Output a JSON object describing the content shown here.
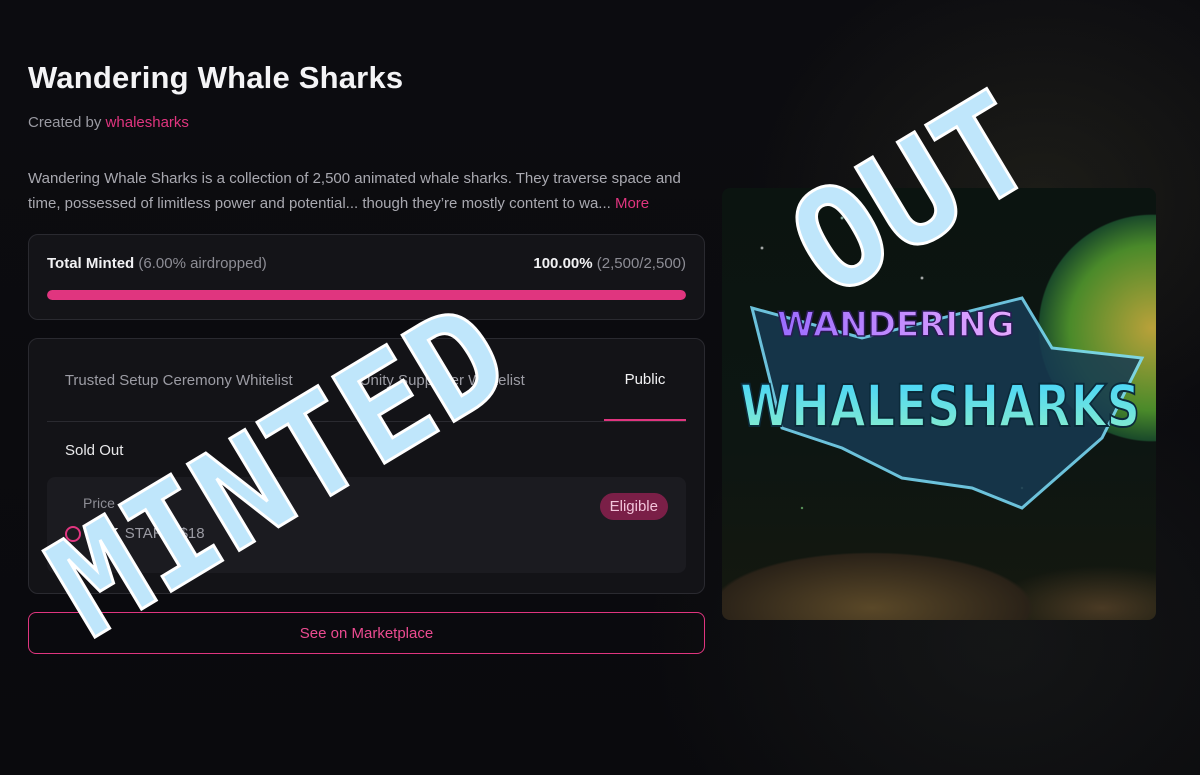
{
  "collection": {
    "title": "Wandering Whale Sharks",
    "created_by_prefix": "Created by",
    "creator": "whalesharks",
    "description": "Wandering Whale Sharks is a collection of 2,500 animated whale sharks. They traverse space and time, possessed of limitless power and potential... though they’re mostly content to wa...",
    "more_link": "More"
  },
  "minting": {
    "label": "Total Minted",
    "airdrop_note": "(6.00% airdropped)",
    "percent_text": "100.00%",
    "count_text": "(2,500/2,500)",
    "progress_percent": 100
  },
  "phases": {
    "tabs": [
      {
        "label": "Trusted Setup Ceremony Whitelist"
      },
      {
        "label": "Unity Supporter Whitelist"
      },
      {
        "label": "Public"
      }
    ],
    "active_tab": "Public",
    "status": "Sold Out",
    "price_label": "Price",
    "price_amount": "1.5K",
    "price_currency": "STARS",
    "price_usd": "$18",
    "badge": "Eligible"
  },
  "buttons": {
    "marketplace": "See on Marketplace"
  },
  "artwork": {
    "line1": "WANDERING",
    "line2": "WHALESHARKS"
  },
  "overlay": {
    "word1": "MINTED",
    "word2": "OUT"
  },
  "colors": {
    "accent": "#e0357f",
    "overlay_fill": "#bfe6fb",
    "overlay_stroke": "#ffffff"
  }
}
